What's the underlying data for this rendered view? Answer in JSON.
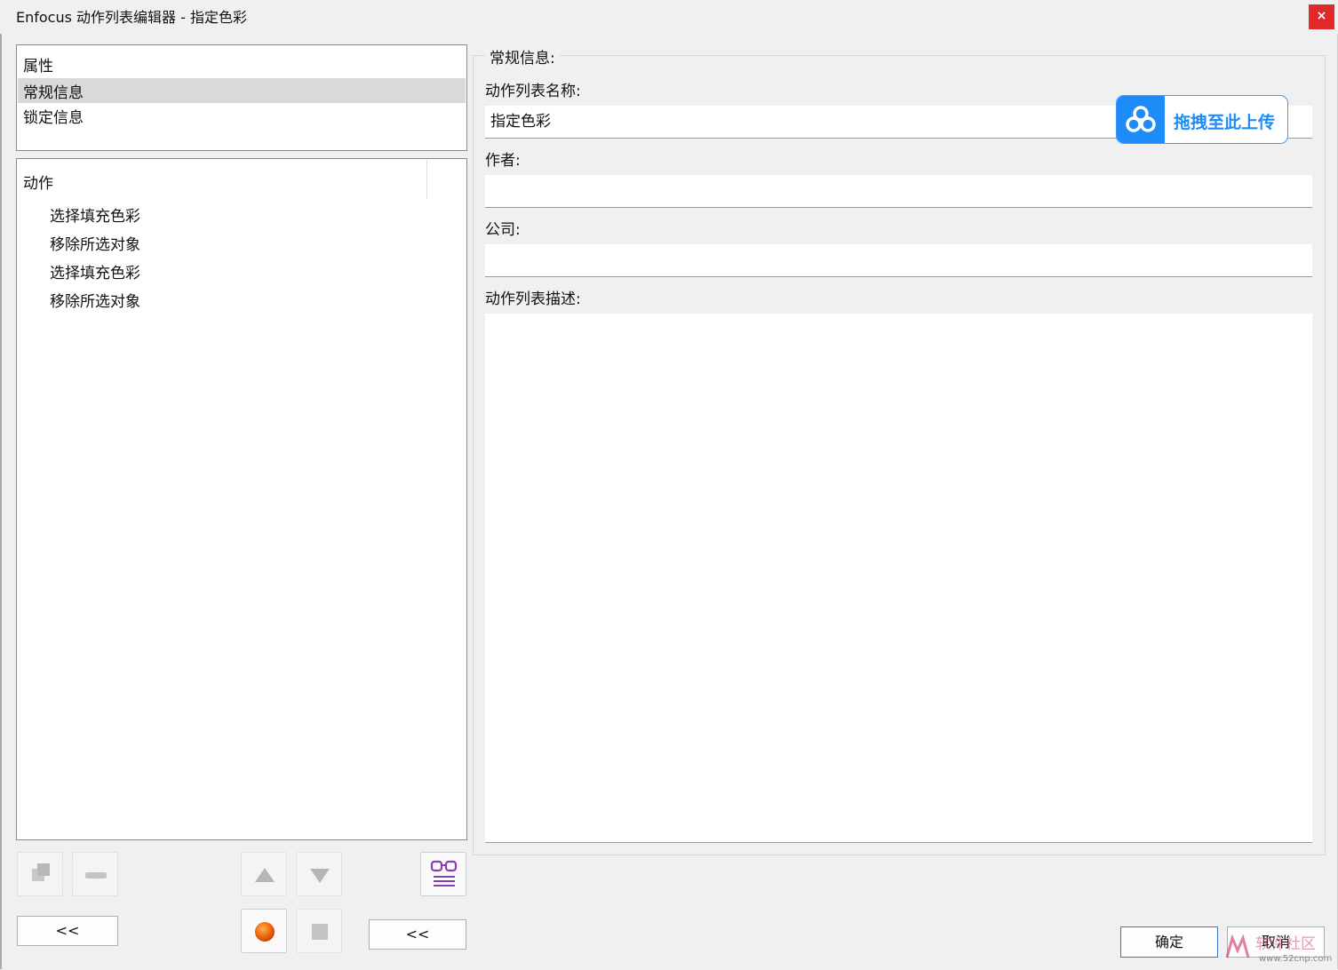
{
  "window": {
    "title": "Enfocus 动作列表编辑器 - 指定色彩",
    "close": "×"
  },
  "properties": {
    "header": "属性",
    "items": [
      "常规信息",
      "锁定信息"
    ],
    "selected": 0
  },
  "actions": {
    "header": "动作",
    "items": [
      "选择填充色彩",
      "移除所选对象",
      "选择填充色彩",
      "移除所选对象"
    ]
  },
  "toolbar": {
    "collapse_left": "<<",
    "collapse_right": "<<"
  },
  "general": {
    "group_title": "常规信息:",
    "name_label": "动作列表名称:",
    "name_value": "指定色彩",
    "author_label": "作者:",
    "author_value": "",
    "company_label": "公司:",
    "company_value": "",
    "description_label": "动作列表描述:",
    "description_value": ""
  },
  "footer": {
    "ok": "确定",
    "cancel": "取消"
  },
  "overlay": {
    "upload_label": "拖拽至此上传"
  },
  "watermark": {
    "text": "www.52cnp.com"
  },
  "colors": {
    "accent": "#1e8cf7",
    "close": "#e02a2a",
    "selection": "#d9d9d9"
  }
}
